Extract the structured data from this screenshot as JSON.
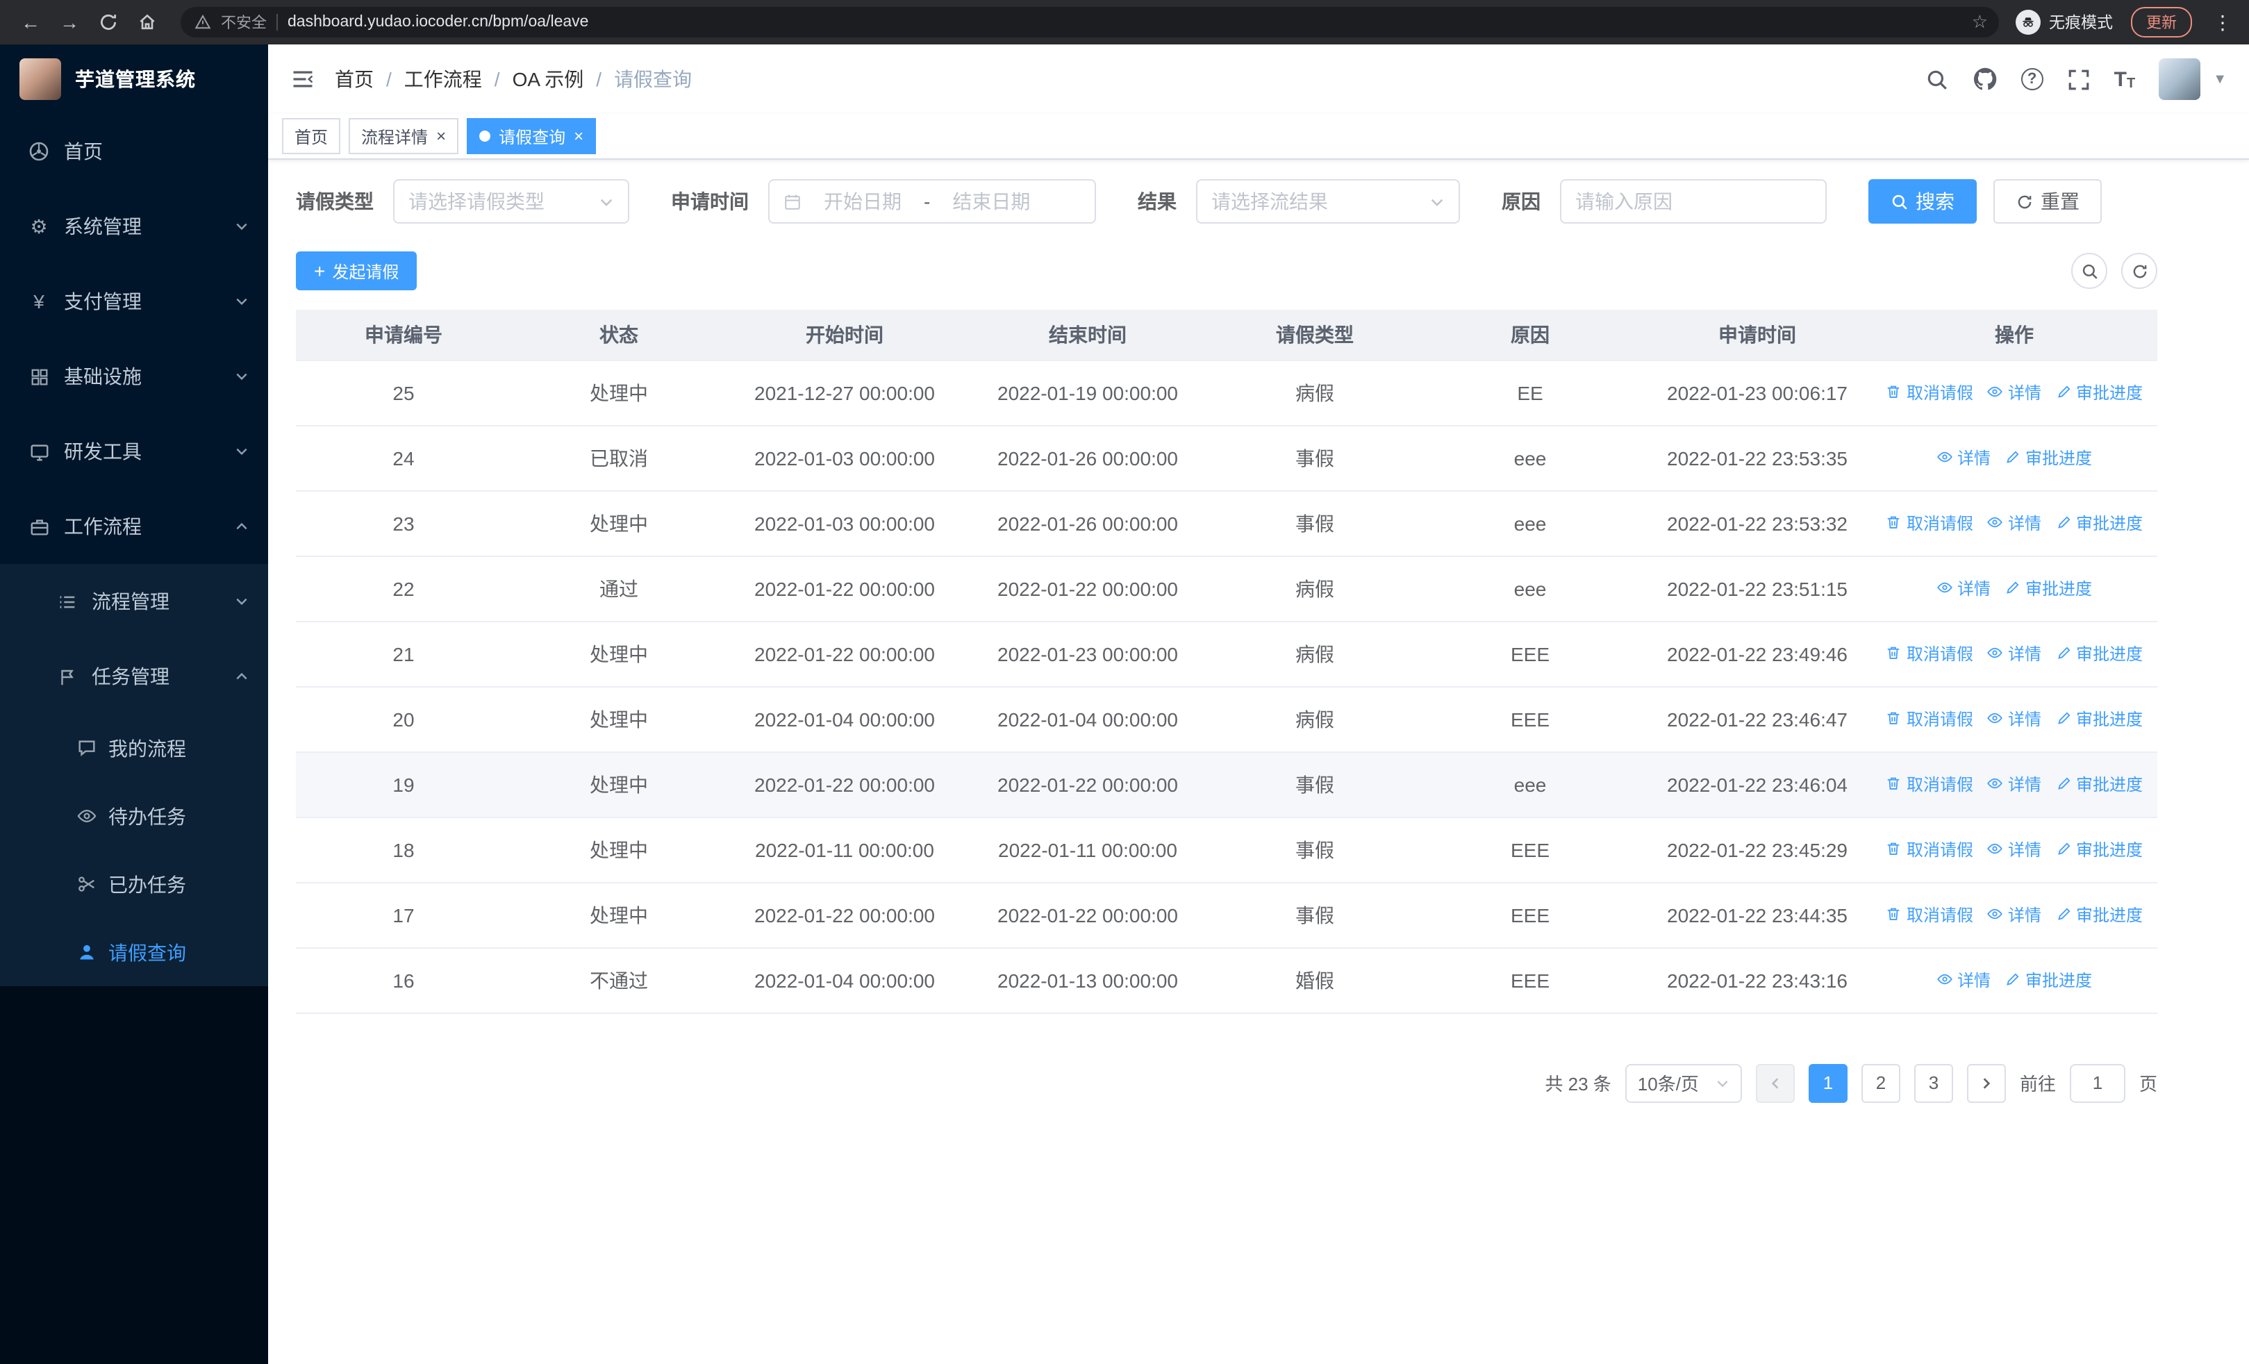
{
  "colors": {
    "primary": "#409eff"
  },
  "browser": {
    "security_label": "不安全",
    "url": "dashboard.yudao.iocoder.cn/bpm/oa/leave",
    "incognito_label": "无痕模式",
    "update_label": "更新"
  },
  "sidebar": {
    "logo_title": "芋道管理系统",
    "items": [
      {
        "label": "首页",
        "icon": "home-icon"
      },
      {
        "label": "系统管理",
        "icon": "gear-icon"
      },
      {
        "label": "支付管理",
        "icon": "yen-icon"
      },
      {
        "label": "基础设施",
        "icon": "infrastructure-icon"
      },
      {
        "label": "研发工具",
        "icon": "dev-tools-icon"
      },
      {
        "label": "工作流程",
        "icon": "workflow-icon",
        "expanded": true
      }
    ],
    "sub_items": [
      {
        "label": "流程管理",
        "icon": "process-list-icon"
      },
      {
        "label": "任务管理",
        "icon": "task-flag-icon",
        "expanded": true
      }
    ],
    "task_items": [
      {
        "label": "我的流程",
        "icon": "chat-icon"
      },
      {
        "label": "待办任务",
        "icon": "eye-icon"
      },
      {
        "label": "已办任务",
        "icon": "done-tasks-icon"
      },
      {
        "label": "请假查询",
        "icon": "user-icon",
        "active": true
      }
    ]
  },
  "navbar": {
    "breadcrumb": [
      "首页",
      "工作流程",
      "OA 示例",
      "请假查询"
    ],
    "separator": "/"
  },
  "tabbar": {
    "close_glyph": "×",
    "tabs": [
      {
        "label": "首页",
        "closable": false,
        "active": false
      },
      {
        "label": "流程详情",
        "closable": true,
        "active": false
      },
      {
        "label": "请假查询",
        "closable": true,
        "active": true
      }
    ]
  },
  "filters": {
    "leave_type_label": "请假类型",
    "leave_type_placeholder": "请选择请假类型",
    "apply_time_label": "申请时间",
    "start_date_placeholder": "开始日期",
    "range_separator": "-",
    "end_date_placeholder": "结束日期",
    "result_label": "结果",
    "result_placeholder": "请选择流结果",
    "reason_label": "原因",
    "reason_placeholder": "请输入原因",
    "search_label": "搜索",
    "reset_label": "重置"
  },
  "toolbar": {
    "create_label": "发起请假"
  },
  "table": {
    "columns": [
      "申请编号",
      "状态",
      "开始时间",
      "结束时间",
      "请假类型",
      "原因",
      "申请时间",
      "操作"
    ],
    "action_labels": {
      "cancel": "取消请假",
      "detail": "详情",
      "progress": "审批进度"
    },
    "rows": [
      {
        "id": "25",
        "status": "处理中",
        "start": "2021-12-27 00:00:00",
        "end": "2022-01-19 00:00:00",
        "type": "病假",
        "reason": "EE",
        "applied": "2022-01-23 00:06:17",
        "actions": [
          "cancel",
          "detail",
          "progress"
        ]
      },
      {
        "id": "24",
        "status": "已取消",
        "start": "2022-01-03 00:00:00",
        "end": "2022-01-26 00:00:00",
        "type": "事假",
        "reason": "eee",
        "applied": "2022-01-22 23:53:35",
        "actions": [
          "detail",
          "progress"
        ]
      },
      {
        "id": "23",
        "status": "处理中",
        "start": "2022-01-03 00:00:00",
        "end": "2022-01-26 00:00:00",
        "type": "事假",
        "reason": "eee",
        "applied": "2022-01-22 23:53:32",
        "actions": [
          "cancel",
          "detail",
          "progress"
        ]
      },
      {
        "id": "22",
        "status": "通过",
        "start": "2022-01-22 00:00:00",
        "end": "2022-01-22 00:00:00",
        "type": "病假",
        "reason": "eee",
        "applied": "2022-01-22 23:51:15",
        "actions": [
          "detail",
          "progress"
        ]
      },
      {
        "id": "21",
        "status": "处理中",
        "start": "2022-01-22 00:00:00",
        "end": "2022-01-23 00:00:00",
        "type": "病假",
        "reason": "EEE",
        "applied": "2022-01-22 23:49:46",
        "actions": [
          "cancel",
          "detail",
          "progress"
        ]
      },
      {
        "id": "20",
        "status": "处理中",
        "start": "2022-01-04 00:00:00",
        "end": "2022-01-04 00:00:00",
        "type": "病假",
        "reason": "EEE",
        "applied": "2022-01-22 23:46:47",
        "actions": [
          "cancel",
          "detail",
          "progress"
        ]
      },
      {
        "id": "19",
        "status": "处理中",
        "start": "2022-01-22 00:00:00",
        "end": "2022-01-22 00:00:00",
        "type": "事假",
        "reason": "eee",
        "applied": "2022-01-22 23:46:04",
        "actions": [
          "cancel",
          "detail",
          "progress"
        ],
        "hover": true
      },
      {
        "id": "18",
        "status": "处理中",
        "start": "2022-01-11 00:00:00",
        "end": "2022-01-11 00:00:00",
        "type": "事假",
        "reason": "EEE",
        "applied": "2022-01-22 23:45:29",
        "actions": [
          "cancel",
          "detail",
          "progress"
        ]
      },
      {
        "id": "17",
        "status": "处理中",
        "start": "2022-01-22 00:00:00",
        "end": "2022-01-22 00:00:00",
        "type": "事假",
        "reason": "EEE",
        "applied": "2022-01-22 23:44:35",
        "actions": [
          "cancel",
          "detail",
          "progress"
        ]
      },
      {
        "id": "16",
        "status": "不通过",
        "start": "2022-01-04 00:00:00",
        "end": "2022-01-13 00:00:00",
        "type": "婚假",
        "reason": "EEE",
        "applied": "2022-01-22 23:43:16",
        "actions": [
          "detail",
          "progress"
        ]
      }
    ]
  },
  "pagination": {
    "total_label": "共 23 条",
    "page_size": "10条/页",
    "pages": [
      "1",
      "2",
      "3"
    ],
    "active_page": "1",
    "goto_label": "前往",
    "goto_value": "1",
    "goto_suffix": "页"
  }
}
